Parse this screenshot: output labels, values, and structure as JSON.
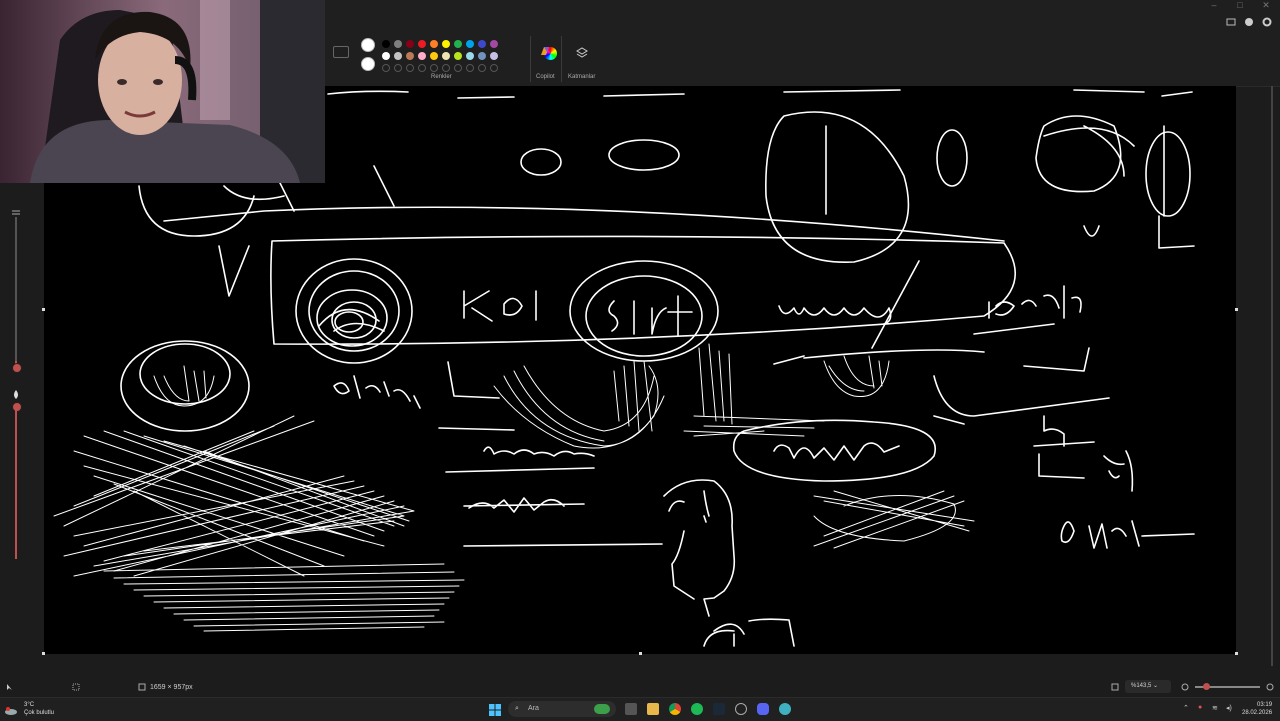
{
  "ribbon": {
    "window_controls": [
      "–",
      "□",
      "✕"
    ],
    "colors_label": "Renkler",
    "copilot_label": "Copilot",
    "layers_label": "Katmanlar",
    "primary_color": "#ffffff",
    "secondary_color": "#ffffff",
    "palette_row1": [
      "#000000",
      "#7f7f7f",
      "#880015",
      "#ed1c24",
      "#ff7f27",
      "#fff200",
      "#22b14c",
      "#00a2e8",
      "#3f48cc",
      "#a349a4"
    ],
    "palette_row2": [
      "#ffffff",
      "#c3c3c3",
      "#b97a57",
      "#ffaec9",
      "#ffc90e",
      "#efe4b0",
      "#b5e61d",
      "#99d9ea",
      "#7092be",
      "#c8bfe7"
    ]
  },
  "status": {
    "canvas_size": "1659 × 957px",
    "zoom": "%143,5"
  },
  "taskbar": {
    "weather_temp": "3°C",
    "weather_desc": "Çok bulutlu",
    "search_placeholder": "Ara",
    "time": "03:19",
    "date": "28.02.2026"
  },
  "icons": [
    "cursor-icon",
    "selection-icon",
    "canvas-size-icon",
    "fit-screen-icon",
    "zoom-out-icon",
    "zoom-in-icon",
    "windows-start-icon",
    "search-icon",
    "file-explorer-icon",
    "chrome-icon",
    "spotify-icon",
    "steam-icon",
    "discord-icon",
    "settings-icon",
    "copilot-icon",
    "layers-icon",
    "wifi-icon",
    "volume-icon",
    "microphone-icon"
  ]
}
